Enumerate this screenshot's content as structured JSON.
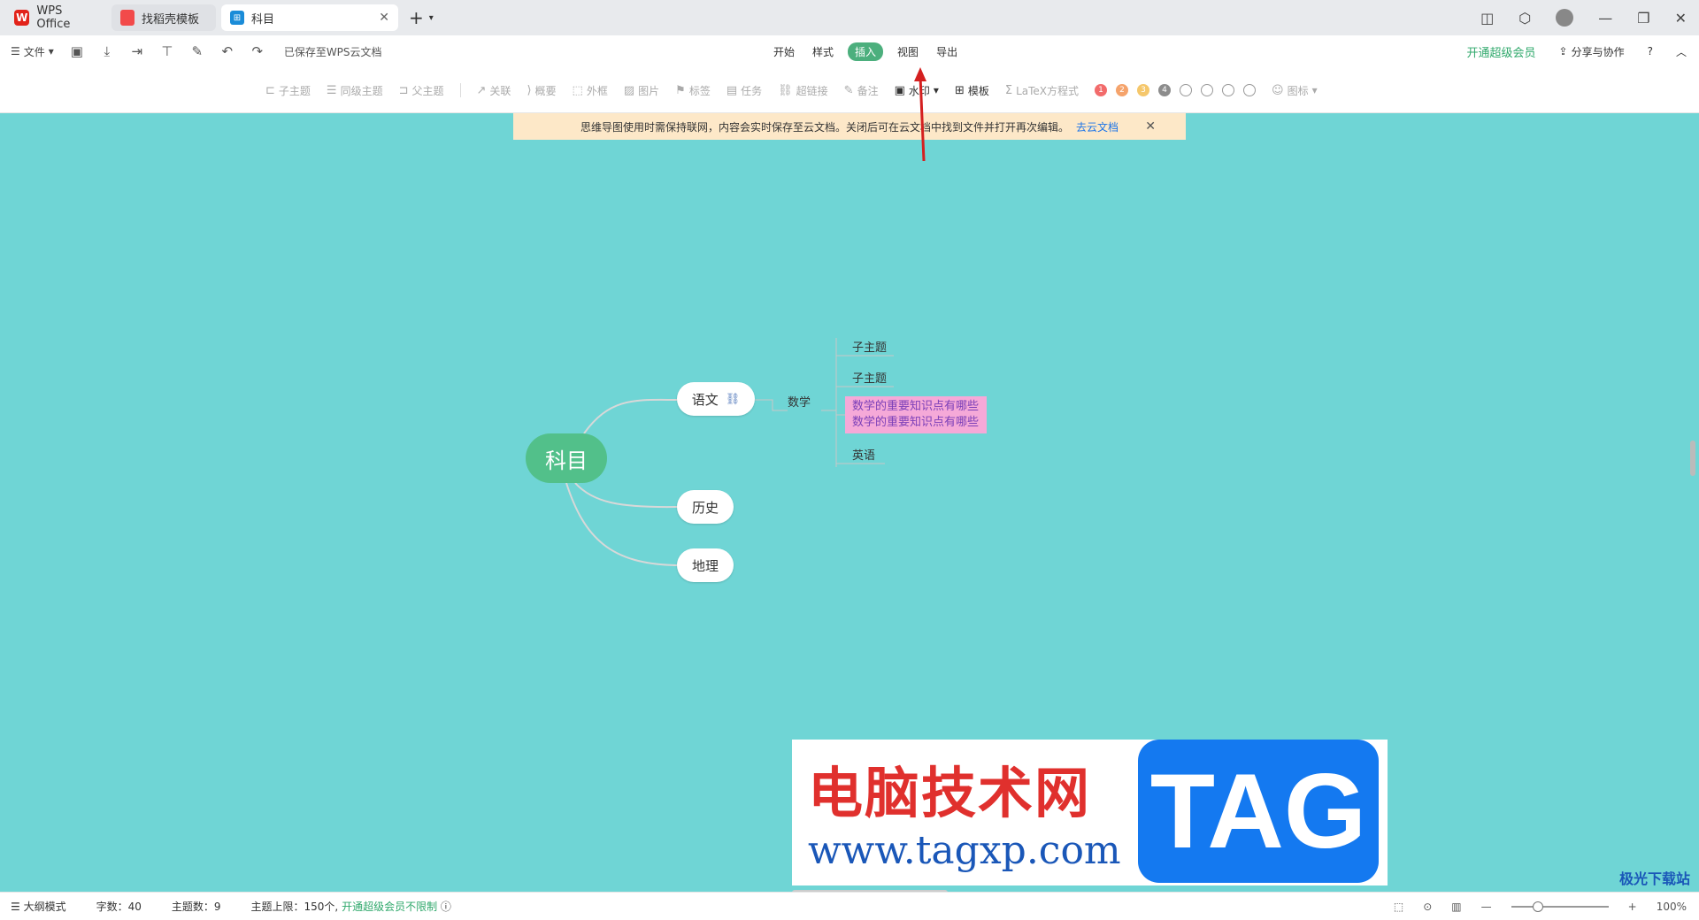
{
  "tabs": {
    "wps": "WPS Office",
    "template": "找稻壳模板",
    "active": "科目",
    "active_icon": "mindmap-icon"
  },
  "menubar": {
    "file": "文件",
    "saved": "已保存至WPS云文档",
    "tabs": [
      "开始",
      "样式",
      "插入",
      "视图",
      "导出"
    ],
    "active_tab": "插入",
    "vip": "开通超级会员",
    "share": "分享与协作",
    "help": "?"
  },
  "ribbon": {
    "child_topic": "子主题",
    "sibling_topic": "同级主题",
    "parent_topic": "父主题",
    "relation": "关联",
    "summary": "概要",
    "frame": "外框",
    "image": "图片",
    "tag": "标签",
    "task": "任务",
    "hyperlink": "超链接",
    "note": "备注",
    "watermark": "水印",
    "template": "模板",
    "latex": "LaTeX方程式",
    "icon": "图标",
    "priority_colors": [
      "#f26b6b",
      "#f5a36b",
      "#f5c76b",
      "#8c8c8c"
    ],
    "priority_labels": [
      "1",
      "2",
      "3",
      "4"
    ]
  },
  "notice": {
    "text": "思维导图使用时需保持联网，内容会实时保存至云文档。关闭后可在云文档中找到文件并打开再次编辑。",
    "link": "去云文档"
  },
  "mindmap": {
    "root": "科目",
    "branches": [
      "语文",
      "历史",
      "地理"
    ],
    "sub": "数学",
    "leaves": [
      "子主题",
      "子主题",
      "英语"
    ],
    "highlight_line1": "数学的重要知识点有哪些",
    "highlight_line2": "数学的重要知识点有哪些"
  },
  "watermark_banner": {
    "title": "电脑技术网",
    "url": "www.tagxp.com",
    "tag": "TAG"
  },
  "statusbar": {
    "outline": "大纲模式",
    "word_count": "字数：40",
    "topic_count": "主题数：9",
    "topic_limit": "主题上限：150个,",
    "vip_unlimited": "开通超级会员不限制",
    "zoom": "100%"
  },
  "corner_logo": "极光下载站",
  "colors": {
    "canvas": "#6fd5d5",
    "root": "#52c08a",
    "accent": "#4caf7d",
    "highlight": "#f5a9d8"
  }
}
